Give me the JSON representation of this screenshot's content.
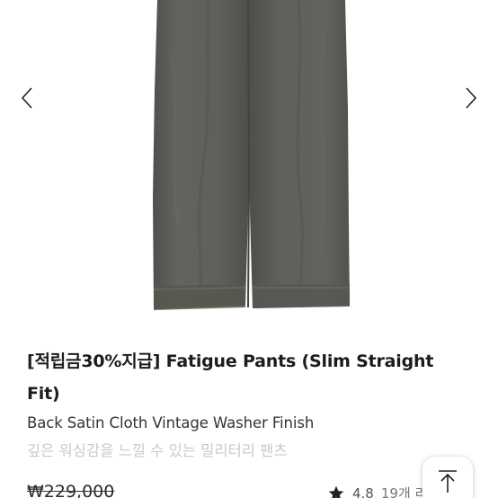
{
  "product": {
    "title_line1": "[적립금30%지급] Fatigue Pants (Slim Straight",
    "title_line2": "Fit)",
    "subtitle": "Back Satin Cloth Vintage Washer Finish",
    "description": "깊은 워싱감을 느낄 수 있는 밀리터리 팬츠",
    "price": "₩229,000",
    "rating": "4.8",
    "review_count": "19개 리"
  },
  "gallery": {
    "image": "fatigue-pants-product-photo",
    "prev_icon": "chevron-left-icon",
    "next_icon": "chevron-right-icon",
    "pants_color": "#5e5e59"
  },
  "controls": {
    "scroll_top_icon": "arrow-up-to-top-icon"
  },
  "colors": {
    "title": "#1c1c1c",
    "subtitle": "#333333",
    "description": "#c9c9c9",
    "star": "#222222"
  }
}
